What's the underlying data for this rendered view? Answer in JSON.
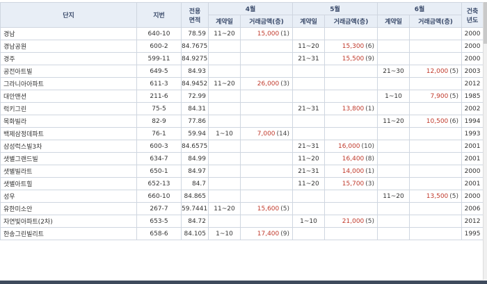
{
  "headers": {
    "complex": "단지",
    "lot": "지번",
    "area_line1": "전용",
    "area_line2": "면적",
    "month4": "4월",
    "month5": "5월",
    "month6": "6월",
    "built_line1": "건축",
    "built_line2": "년도",
    "contract_day": "계약일",
    "amount": "거래금액(층)"
  },
  "rows": [
    {
      "name": "경남",
      "lot": "640-10",
      "area": "78.59",
      "m4_day": "11~20",
      "m4_amt": "15,000",
      "m4_floor": "(1)",
      "m5_day": "",
      "m5_amt": "",
      "m5_floor": "",
      "m6_day": "",
      "m6_amt": "",
      "m6_floor": "",
      "year": "2000"
    },
    {
      "name": "경남공원",
      "lot": "600-2",
      "area": "84.7675",
      "m4_day": "",
      "m4_amt": "",
      "m4_floor": "",
      "m5_day": "11~20",
      "m5_amt": "15,300",
      "m5_floor": "(6)",
      "m6_day": "",
      "m6_amt": "",
      "m6_floor": "",
      "year": "2000"
    },
    {
      "name": "경주",
      "lot": "599-11",
      "area": "84.9275",
      "m4_day": "",
      "m4_amt": "",
      "m4_floor": "",
      "m5_day": "21~31",
      "m5_amt": "15,500",
      "m5_floor": "(9)",
      "m6_day": "",
      "m6_amt": "",
      "m6_floor": "",
      "year": "2000"
    },
    {
      "name": "공전아트빌",
      "lot": "649-5",
      "area": "84.93",
      "m4_day": "",
      "m4_amt": "",
      "m4_floor": "",
      "m5_day": "",
      "m5_amt": "",
      "m5_floor": "",
      "m6_day": "21~30",
      "m6_amt": "12,000",
      "m6_floor": "(5)",
      "year": "2003"
    },
    {
      "name": "그라니아아파트",
      "lot": "611-3",
      "area": "84.9452",
      "m4_day": "11~20",
      "m4_amt": "26,000",
      "m4_floor": "(3)",
      "m5_day": "",
      "m5_amt": "",
      "m5_floor": "",
      "m6_day": "",
      "m6_amt": "",
      "m6_floor": "",
      "year": "2012"
    },
    {
      "name": "대안맨션",
      "lot": "211-6",
      "area": "72.99",
      "m4_day": "",
      "m4_amt": "",
      "m4_floor": "",
      "m5_day": "",
      "m5_amt": "",
      "m5_floor": "",
      "m6_day": "1~10",
      "m6_amt": "7,900",
      "m6_floor": "(5)",
      "year": "1985"
    },
    {
      "name": "럭키그린",
      "lot": "75-5",
      "area": "84.31",
      "m4_day": "",
      "m4_amt": "",
      "m4_floor": "",
      "m5_day": "21~31",
      "m5_amt": "13,800",
      "m5_floor": "(1)",
      "m6_day": "",
      "m6_amt": "",
      "m6_floor": "",
      "year": "2002"
    },
    {
      "name": "목화빌라",
      "lot": "82-9",
      "area": "77.86",
      "m4_day": "",
      "m4_amt": "",
      "m4_floor": "",
      "m5_day": "",
      "m5_amt": "",
      "m5_floor": "",
      "m6_day": "11~20",
      "m6_amt": "10,500",
      "m6_floor": "(6)",
      "year": "1994"
    },
    {
      "name": "백제삼정데파트",
      "lot": "76-1",
      "area": "59.94",
      "m4_day": "1~10",
      "m4_amt": "7,000",
      "m4_floor": "(14)",
      "m5_day": "",
      "m5_amt": "",
      "m5_floor": "",
      "m6_day": "",
      "m6_amt": "",
      "m6_floor": "",
      "year": "1993"
    },
    {
      "name": "삼성럭스빌3차",
      "lot": "600-3",
      "area": "84.6575",
      "m4_day": "",
      "m4_amt": "",
      "m4_floor": "",
      "m5_day": "21~31",
      "m5_amt": "16,000",
      "m5_floor": "(10)",
      "m6_day": "",
      "m6_amt": "",
      "m6_floor": "",
      "year": "2001"
    },
    {
      "name": "샛별그랜드빌",
      "lot": "634-7",
      "area": "84.99",
      "m4_day": "",
      "m4_amt": "",
      "m4_floor": "",
      "m5_day": "11~20",
      "m5_amt": "16,400",
      "m5_floor": "(8)",
      "m6_day": "",
      "m6_amt": "",
      "m6_floor": "",
      "year": "2001"
    },
    {
      "name": "샛별빌라트",
      "lot": "650-1",
      "area": "84.97",
      "m4_day": "",
      "m4_amt": "",
      "m4_floor": "",
      "m5_day": "21~31",
      "m5_amt": "14,000",
      "m5_floor": "(1)",
      "m6_day": "",
      "m6_amt": "",
      "m6_floor": "",
      "year": "2000"
    },
    {
      "name": "샛별아트힐",
      "lot": "652-13",
      "area": "84.7",
      "m4_day": "",
      "m4_amt": "",
      "m4_floor": "",
      "m5_day": "11~20",
      "m5_amt": "15,700",
      "m5_floor": "(3)",
      "m6_day": "",
      "m6_amt": "",
      "m6_floor": "",
      "year": "2001"
    },
    {
      "name": "성우",
      "lot": "660-10",
      "area": "84.865",
      "m4_day": "",
      "m4_amt": "",
      "m4_floor": "",
      "m5_day": "",
      "m5_amt": "",
      "m5_floor": "",
      "m6_day": "11~20",
      "m6_amt": "13,500",
      "m6_floor": "(5)",
      "year": "2000"
    },
    {
      "name": "유한미소안",
      "lot": "267-7",
      "area": "59.7441",
      "m4_day": "11~20",
      "m4_amt": "15,600",
      "m4_floor": "(5)",
      "m5_day": "",
      "m5_amt": "",
      "m5_floor": "",
      "m6_day": "",
      "m6_amt": "",
      "m6_floor": "",
      "year": "2006"
    },
    {
      "name": "자연빛아파트(2차)",
      "lot": "653-5",
      "area": "84.72",
      "m4_day": "",
      "m4_amt": "",
      "m4_floor": "",
      "m5_day": "1~10",
      "m5_amt": "21,000",
      "m5_floor": "(5)",
      "m6_day": "",
      "m6_amt": "",
      "m6_floor": "",
      "year": "2012"
    },
    {
      "name": "한송그린빌리트",
      "lot": "658-6",
      "area": "84.105",
      "m4_day": "1~10",
      "m4_amt": "17,400",
      "m4_floor": "(9)",
      "m5_day": "",
      "m5_amt": "",
      "m5_floor": "",
      "m6_day": "",
      "m6_amt": "",
      "m6_floor": "",
      "year": "1995"
    }
  ]
}
